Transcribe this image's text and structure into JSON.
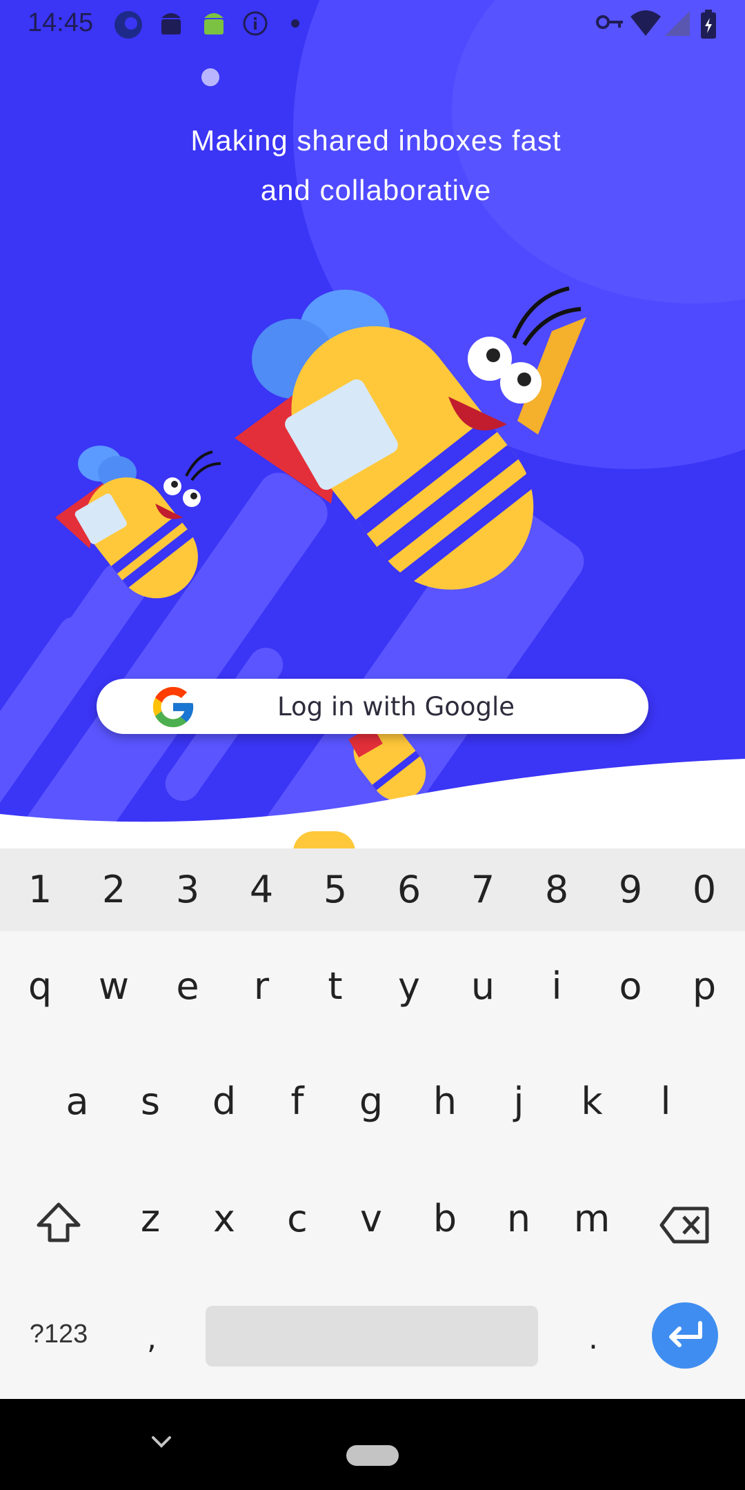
{
  "status_bar": {
    "time": "14:45",
    "icons": [
      "blue-app-icon",
      "android-dark-icon",
      "android-green-icon",
      "info-icon",
      "dot-icon",
      "vpn-key-icon",
      "wifi-icon",
      "signal-icon",
      "battery-charging-icon"
    ]
  },
  "onboarding": {
    "headline_line1": "Making shared inboxes fast",
    "headline_line2": "and collaborative",
    "login_button": {
      "label": "Log in with Google",
      "icon": "google-g-icon"
    }
  },
  "keyboard": {
    "number_row": [
      "1",
      "2",
      "3",
      "4",
      "5",
      "6",
      "7",
      "8",
      "9",
      "0"
    ],
    "row1": [
      "q",
      "w",
      "e",
      "r",
      "t",
      "y",
      "u",
      "i",
      "o",
      "p"
    ],
    "row2": [
      "a",
      "s",
      "d",
      "f",
      "g",
      "h",
      "j",
      "k",
      "l"
    ],
    "row3": [
      "z",
      "x",
      "c",
      "v",
      "b",
      "n",
      "m"
    ],
    "symbols_key": "?123",
    "comma_key": ",",
    "period_key": ".",
    "shift_icon": "shift-icon",
    "backspace_icon": "backspace-icon",
    "enter_icon": "enter-icon"
  },
  "navigation_bar": {
    "back_icon": "chevron-down-icon",
    "home_icon": "home-pill-icon"
  },
  "colors": {
    "hero_background": "#3b35f5",
    "bee_yellow": "#ffc83a",
    "cape_red": "#e32f3a",
    "enter_key_blue": "#3f8df0"
  }
}
